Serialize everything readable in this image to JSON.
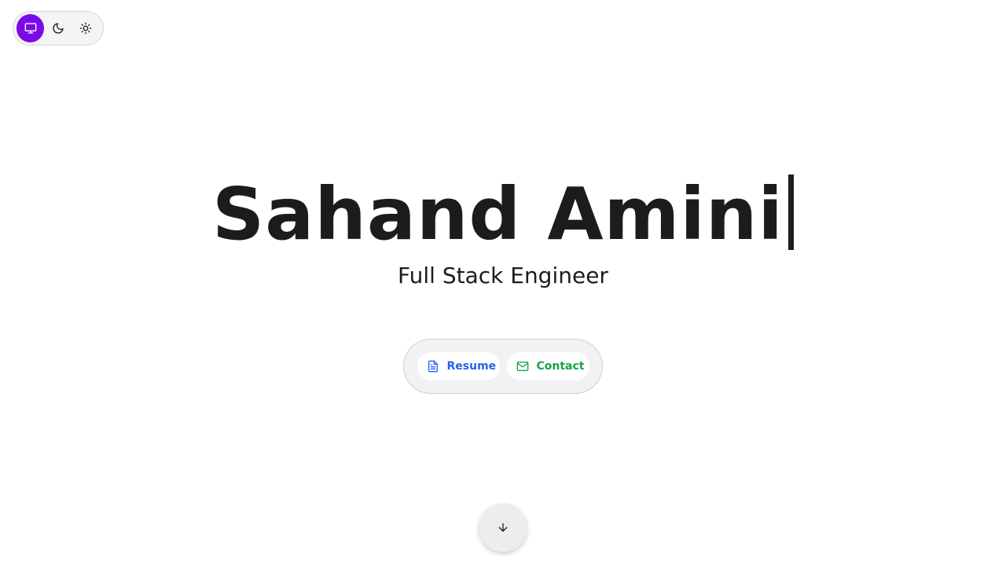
{
  "theme_switcher": {
    "options": [
      {
        "name": "system",
        "icon": "monitor-icon",
        "active": true
      },
      {
        "name": "dark",
        "icon": "moon-icon",
        "active": false
      },
      {
        "name": "light",
        "icon": "sun-icon",
        "active": false
      }
    ],
    "active_color": "#7c0ae6"
  },
  "hero": {
    "name": "Sahand Amini",
    "role": "Full Stack Engineer"
  },
  "actions": {
    "resume_label": "Resume",
    "resume_icon": "file-text-icon",
    "resume_color": "#2563eb",
    "contact_label": "Contact",
    "contact_icon": "mail-icon",
    "contact_color": "#16a34a"
  },
  "scroll": {
    "icon": "arrow-down-icon"
  }
}
